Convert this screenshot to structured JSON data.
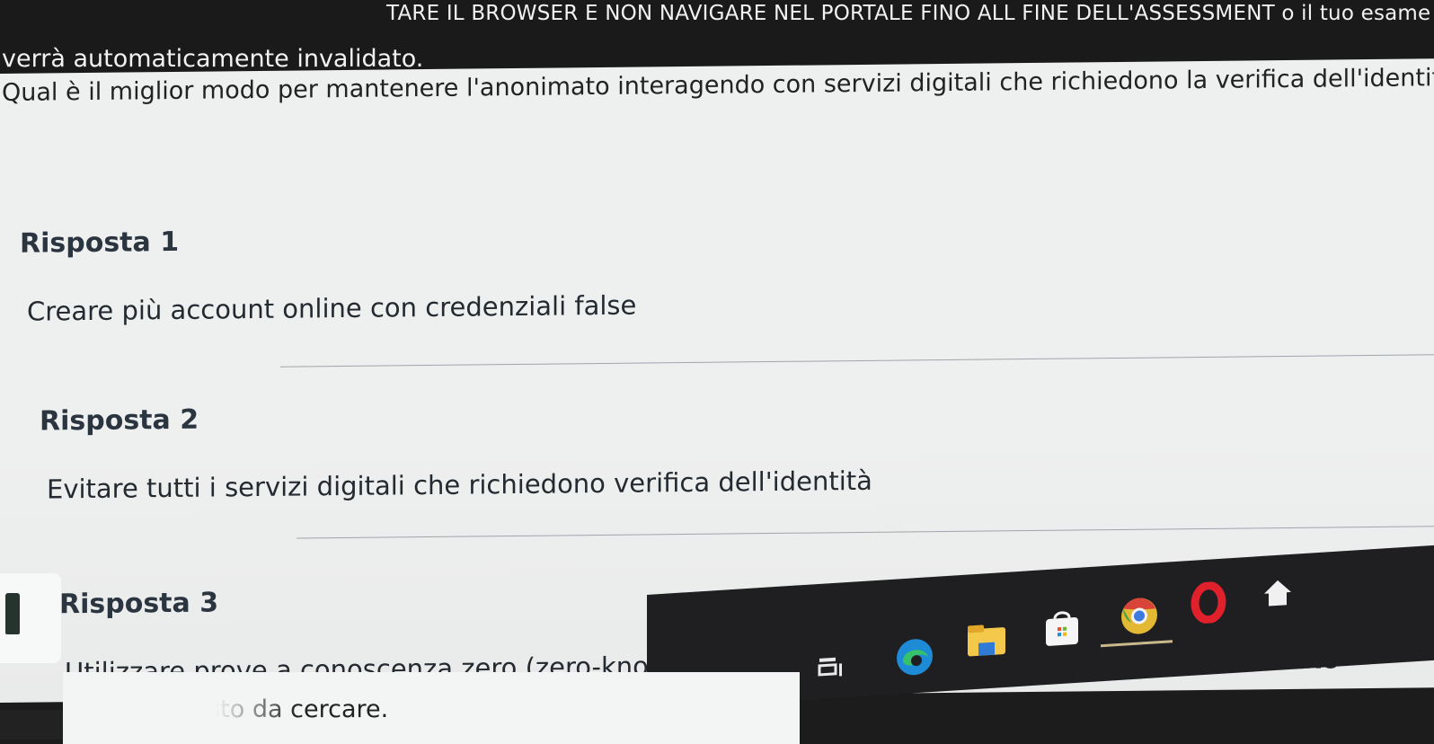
{
  "banner": {
    "line1": "TARE IL BROWSER E NON NAVIGARE NEL PORTALE FINO ALL FINE DELL'ASSESSMENT o il tuo esame",
    "line2": "verrà automaticamente invalidato."
  },
  "question": "Qual è il miglior modo per mantenere l'anonimato interagendo con servizi digitali che richiedono la verifica dell'identità?",
  "answers": [
    {
      "title": "Risposta 1",
      "text": "Creare più account online con credenziali false"
    },
    {
      "title": "Risposta 2",
      "text": "Evitare tutti i servizi digitali che richiedono verifica dell'identità"
    },
    {
      "title": "Risposta 3",
      "text": "Utilizzare prove a conoscenza zero (zero-knowledge proofs) e soluzioni di identità decentralizzate"
    }
  ],
  "taskbar": {
    "search_placeholder": "qui il testo da cercare.",
    "icons": [
      "task-view-icon",
      "edge-icon",
      "file-explorer-icon",
      "store-icon",
      "chrome-icon",
      "opera-icon",
      "home-icon"
    ]
  },
  "colors": {
    "banner_bg": "#1a1a1a",
    "page_bg": "#eef0f0",
    "title_color": "#2b3540",
    "taskbar_bg": "#1f1f22"
  }
}
